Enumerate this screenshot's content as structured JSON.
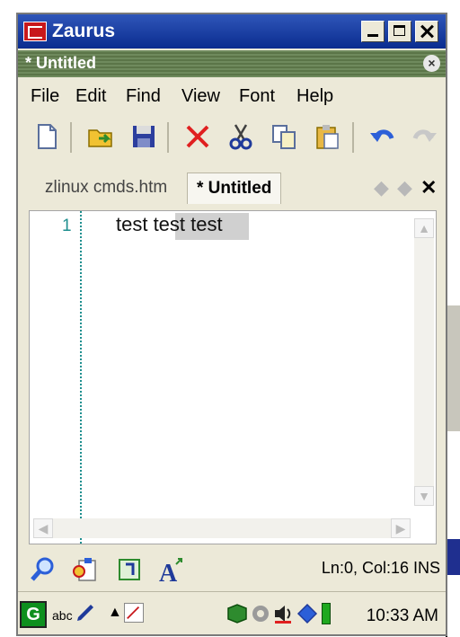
{
  "window": {
    "title": "Zaurus"
  },
  "document": {
    "title": "* Untitled"
  },
  "menu": {
    "items": [
      "File",
      "Edit",
      "Find",
      "View",
      "Font",
      "Help"
    ]
  },
  "toolbar": {
    "buttons": [
      "new-file-icon",
      "open-folder-icon",
      "save-icon",
      "delete-icon",
      "cut-icon",
      "copy-icon",
      "paste-icon",
      "undo-icon",
      "redo-icon"
    ]
  },
  "tabs": [
    {
      "label": "zlinux cmds.htm",
      "active": false
    },
    {
      "label": "* Untitled",
      "active": true
    }
  ],
  "editor": {
    "lines": [
      {
        "number": "1",
        "text": "test test test"
      }
    ]
  },
  "statusbar": {
    "position": "Ln:0, Col:16 INS"
  },
  "taskbar": {
    "input_method": "abc",
    "time": "10:33 AM"
  },
  "colors": {
    "title_bar": "#0a2c8f",
    "doc_title_bar": "#5b7548",
    "line_number": "#1f8f8f",
    "delete": "#e02020"
  }
}
